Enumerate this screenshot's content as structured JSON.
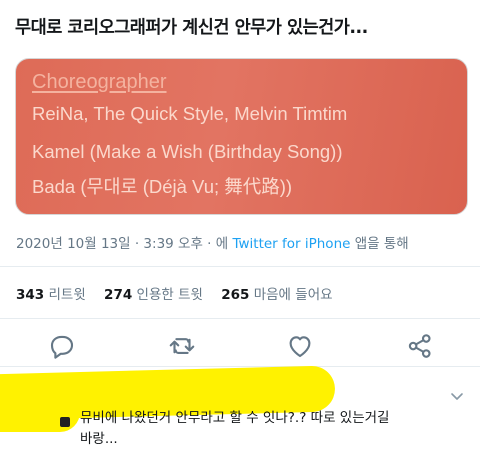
{
  "tweet": {
    "text": "무대로 코리오그래퍼가 계신건 안무가 있는건가..."
  },
  "media": {
    "heading": "Choreographer",
    "lines": [
      "ReiNa, The Quick Style, Melvin Timtim",
      "Kamel (Make a Wish (Birthday Song))",
      "Bada (무대로 (Déjà Vu; 舞代路))"
    ]
  },
  "meta": {
    "date": "2020년 10월 13일 · 3:39 오후 · 에 ",
    "source": "Twitter for iPhone",
    "suffix": " 앱을 통해"
  },
  "stats": {
    "retweets": {
      "count": "343",
      "label": "리트윗"
    },
    "quotes": {
      "count": "274",
      "label": "인용한 트윗"
    },
    "likes": {
      "count": "265",
      "label": "마음에 들어요"
    }
  },
  "reply": {
    "text_line1": "뮤비에 나왔던거 안무라고 할 수 잇나?.? 따로 있는거길",
    "text_line2": "바랑..."
  },
  "colors": {
    "accent": "#1da1f2",
    "media_bg": "#de6b57",
    "highlight": "#fff200"
  },
  "icons": [
    "reply-icon",
    "retweet-icon",
    "like-icon",
    "share-icon",
    "chevron-down-icon"
  ]
}
